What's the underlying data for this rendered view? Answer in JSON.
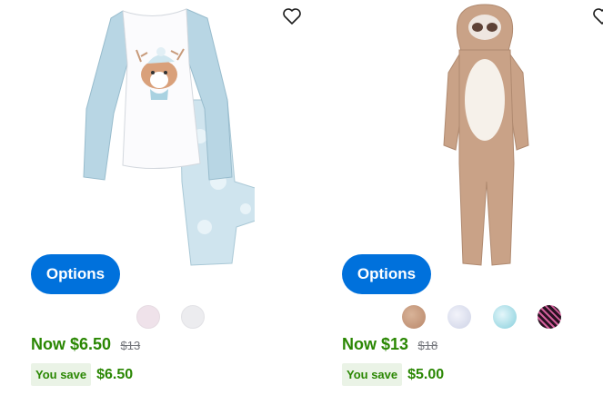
{
  "products": [
    {
      "image_icon": "pajama-set-image",
      "options_label": "Options",
      "swatches": [
        "#efe2ea",
        "#ececef"
      ],
      "price_now": "Now $6.50",
      "price_was": "$13",
      "save_label": "You save",
      "save_amount": "$6.50"
    },
    {
      "image_icon": "sloth-onesie-image",
      "options_label": "Options",
      "swatches": [
        "#c99b7a",
        "#dfe2ef",
        "#a8dce6",
        "#3a1930"
      ],
      "price_now": "Now $13",
      "price_was": "$18",
      "save_label": "You save",
      "save_amount": "$5.00"
    }
  ],
  "colors": {
    "accent": "#0071dc",
    "price_green": "#2a8703",
    "save_bg": "#eaf3e6"
  }
}
